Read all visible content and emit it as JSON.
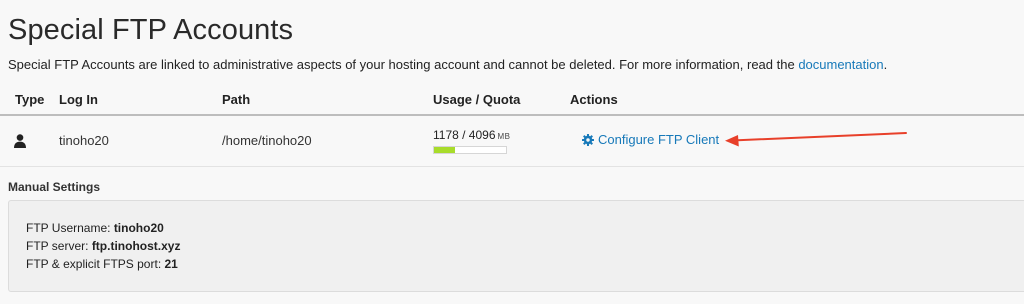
{
  "page": {
    "title": "Special FTP Accounts",
    "description_text": "Special FTP Accounts are linked to administrative aspects of your hosting account and cannot be deleted. For more information, read the ",
    "documentation_link": "documentation",
    "description_end": "."
  },
  "table": {
    "headers": {
      "type": "Type",
      "login": "Log In",
      "path": "Path",
      "usage": "Usage / Quota",
      "actions": "Actions"
    },
    "row": {
      "type_icon": "user-icon",
      "login": "tinoho20",
      "path": "/home/tinoho20",
      "usage": "1178 / 4096",
      "usage_unit": "MB",
      "usage_fraction": 0.29,
      "action_icon": "gear-icon",
      "action_label": "Configure FTP Client"
    }
  },
  "manual": {
    "title": "Manual Settings",
    "username_label": "FTP Username:",
    "username_value": "tinoho20",
    "server_label": "FTP server:",
    "server_value": "ftp.tinohost.xyz",
    "port_label": "FTP & explicit FTPS port:",
    "port_value": "21"
  },
  "colors": {
    "link": "#1779b9",
    "quota_fill": "#a8dc2b",
    "annotation_arrow": "#e8402a"
  }
}
